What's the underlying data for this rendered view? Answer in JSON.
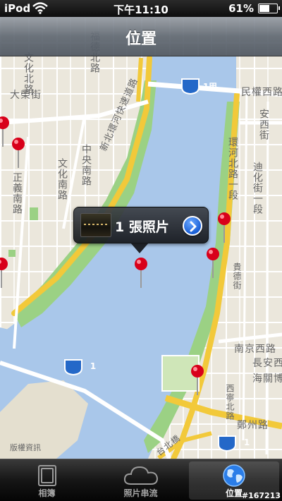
{
  "status_bar": {
    "carrier": "iPod",
    "time": "下午11:10",
    "battery_percent": "61%",
    "battery_level": 0.61
  },
  "nav_bar": {
    "title": "位置"
  },
  "map": {
    "road_labels": {
      "wenhua_bei": "文化北路",
      "dayu": "大榮街",
      "fude_bei": "福德北路",
      "xinbei_huanhe": "新北環河快速道路",
      "zhengyi_nan": "正義南路",
      "zhongyang_nan": "中央南路",
      "wenhua_nan": "文化南路",
      "minquan_xi": "民權西路",
      "anxi": "安西街",
      "dihua": "迪化街一段",
      "huanhe_bei": "環河北路一段",
      "guide": "貴德街",
      "nanjing_xi": "南京西路",
      "changan_xi": "長安西路",
      "haiguan": "海關博",
      "xining": "西寧北路",
      "zhengzhou": "鄭州路",
      "taibei_qiao": "台北橋"
    },
    "shields": [
      "1甲",
      "1",
      "1"
    ],
    "copyright": "版權資訊",
    "pin_color": "#d8001a",
    "water_color": "#a9c7ea",
    "park_color": "#9bd184"
  },
  "callout": {
    "label": "1 張照片",
    "thumb_icon": "photo-thumbnail",
    "disclosure_icon": "chevron-right-icon"
  },
  "tab_bar": {
    "items": [
      {
        "label": "相簿",
        "icon": "albums-icon",
        "active": false
      },
      {
        "label": "照片串流",
        "icon": "cloud-icon",
        "active": false
      },
      {
        "label": "位置",
        "icon": "globe-icon",
        "active": true
      }
    ]
  },
  "watermark": "#167213"
}
